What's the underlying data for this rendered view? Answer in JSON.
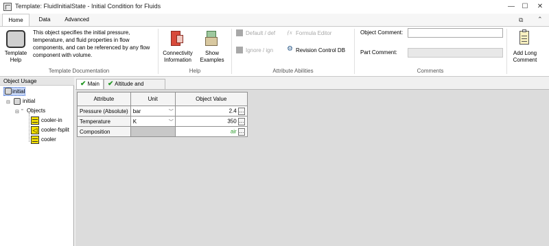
{
  "window": {
    "title": "Template: FluidInitialState - Initial Condition for Fluids",
    "min": "—",
    "max": "☐",
    "close": "✕"
  },
  "ribbon_tabs": [
    "Home",
    "Data",
    "Advanced"
  ],
  "template_documentation": {
    "button_label_1": "Template",
    "button_label_2": "Help",
    "description": "This object specifies the initial pressure, temperature, and fluid properties in flow components, and can be referenced by any flow component with volume.",
    "group_label": "Template Documentation"
  },
  "help_group": {
    "connectivity_1": "Connectivity",
    "connectivity_2": "Information",
    "examples_1": "Show",
    "examples_2": "Examples",
    "group_label": "Help"
  },
  "attribute_abilities": {
    "default_def": "Default / def",
    "formula_editor": "Formula Editor",
    "ignore_ign": "Ignore / ign",
    "revision_control": "Revision Control DB",
    "group_label": "Attribute Abilities"
  },
  "comments": {
    "object_comment": "Object Comment:",
    "part_comment": "Part Comment:",
    "add_long_1": "Add Long",
    "add_long_2": "Comment",
    "group_label": "Comments"
  },
  "tree": {
    "header": "Object Usage",
    "root": "initial",
    "child": "initial",
    "objects": "Objects",
    "items": [
      "cooler-in",
      "cooler-fsplit",
      "cooler"
    ]
  },
  "tabs": [
    "Main",
    "Altitude and Humidity"
  ],
  "table": {
    "headers": [
      "Attribute",
      "Unit",
      "Object Value"
    ],
    "rows": [
      {
        "attribute": "Pressure (Absolute)",
        "unit": "bar",
        "value": "2.4"
      },
      {
        "attribute": "Temperature",
        "unit": "K",
        "value": "350"
      },
      {
        "attribute": "Composition",
        "unit": "",
        "value": "air"
      }
    ]
  },
  "colors": {
    "accent_green": "#2a9a2a",
    "selection": "#c6d6f6"
  }
}
